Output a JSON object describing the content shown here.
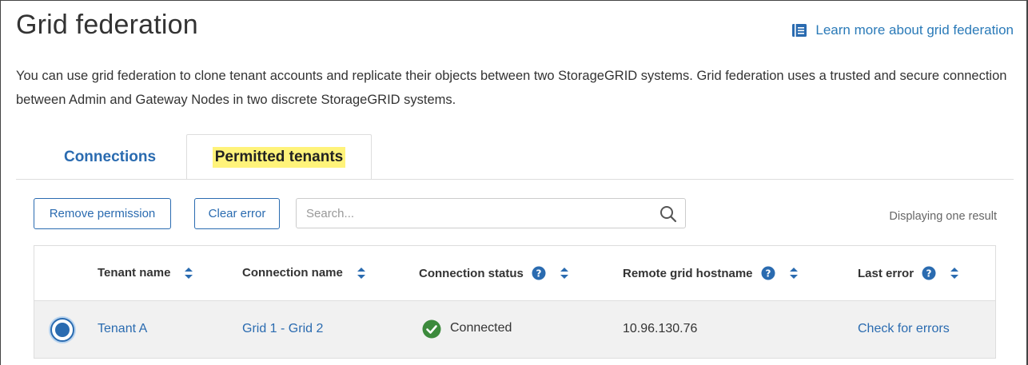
{
  "page": {
    "title": "Grid federation",
    "learn_more": "Learn more about grid federation",
    "description": "You can use grid federation to clone tenant accounts and replicate their objects between two StorageGRID systems. Grid federation uses a trusted and secure connection between Admin and Gateway Nodes in two discrete StorageGRID systems."
  },
  "tabs": [
    {
      "label": "Connections",
      "active": false
    },
    {
      "label": "Permitted tenants",
      "active": true
    }
  ],
  "toolbar": {
    "remove_label": "Remove permission",
    "clear_label": "Clear error",
    "search_placeholder": "Search...",
    "result_count": "Displaying one result"
  },
  "table": {
    "columns": [
      {
        "label": "Tenant name",
        "help": false
      },
      {
        "label": "Connection name",
        "help": false
      },
      {
        "label": "Connection status",
        "help": true
      },
      {
        "label": "Remote grid hostname",
        "help": true
      },
      {
        "label": "Last error",
        "help": true
      }
    ],
    "rows": [
      {
        "selected": true,
        "tenant_name": "Tenant A",
        "connection_name": "Grid 1 - Grid 2",
        "connection_status": "Connected",
        "remote_grid_hostname": "10.96.130.76",
        "last_error": "Check for errors"
      }
    ]
  },
  "colors": {
    "link": "#2a6bb0",
    "success": "#3c8a3c",
    "highlight": "#fff37a"
  },
  "icons": {
    "learn_more": "book-icon",
    "search": "search-icon",
    "sort": "sort-icon",
    "help": "help-icon",
    "status": "check-circle-icon"
  }
}
